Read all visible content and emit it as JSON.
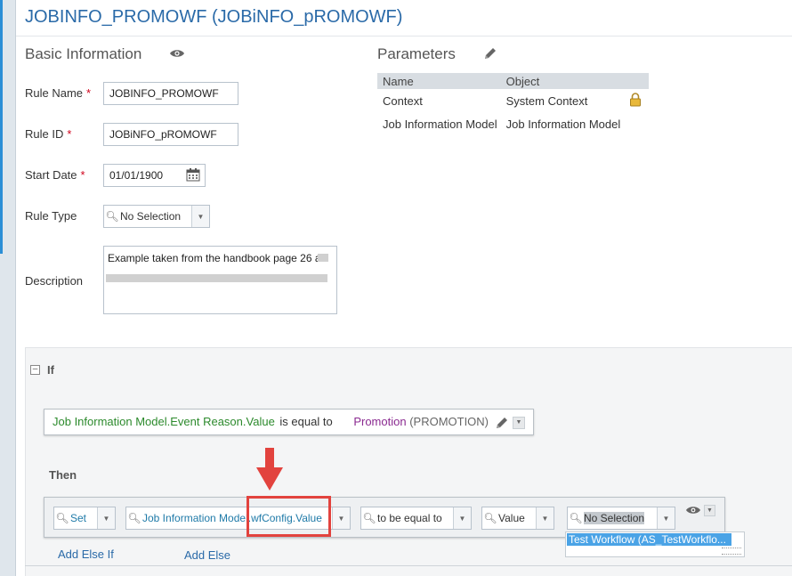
{
  "page": {
    "title": "JOBINFO_PROMOWF (JOBiNFO_pROMOWF)"
  },
  "basic_info": {
    "title": "Basic Information",
    "icon": "eye-icon",
    "rule_name": {
      "label": "Rule Name",
      "value": "JOBINFO_PROMOWF"
    },
    "rule_id": {
      "label": "Rule ID",
      "value": "JOBiNFO_pROMOWF"
    },
    "start_date": {
      "label": "Start Date",
      "value": "01/01/1900"
    },
    "rule_type": {
      "label": "Rule Type",
      "value": "No Selection"
    },
    "description": {
      "label": "Description",
      "value": "Example taken from the handbook page 26 a"
    },
    "required_marker": "*"
  },
  "parameters": {
    "title": "Parameters",
    "icon": "pencil-icon",
    "columns": [
      "Name",
      "Object"
    ],
    "rows": [
      {
        "name": "Context",
        "object": "System Context",
        "locked": true
      },
      {
        "name": "Job Information Model",
        "object": "Job Information Model",
        "locked": false
      }
    ]
  },
  "if_section": {
    "label": "If",
    "condition": {
      "field": "Job Information Model.Event Reason.Value",
      "operator": "is equal to",
      "value": "Promotion",
      "value_code": "(PROMOTION)"
    }
  },
  "then_section": {
    "label": "Then",
    "action": "Set",
    "field": "Job Information Model.wfConfig.Value",
    "operator": "to be equal to",
    "value_type": "Value",
    "value": "No Selection",
    "dropdown_option": "Test Workflow (AS_TestWorkflo..."
  },
  "footer": {
    "add_else_if": "Add Else If",
    "add_else": "Add Else"
  },
  "colors": {
    "title_blue": "#2a6aa8",
    "condition_green": "#2c8a2c",
    "condition_purple": "#8a2a90",
    "highlight_red": "#e2433e",
    "selection_blue": "#4aa3e6"
  }
}
